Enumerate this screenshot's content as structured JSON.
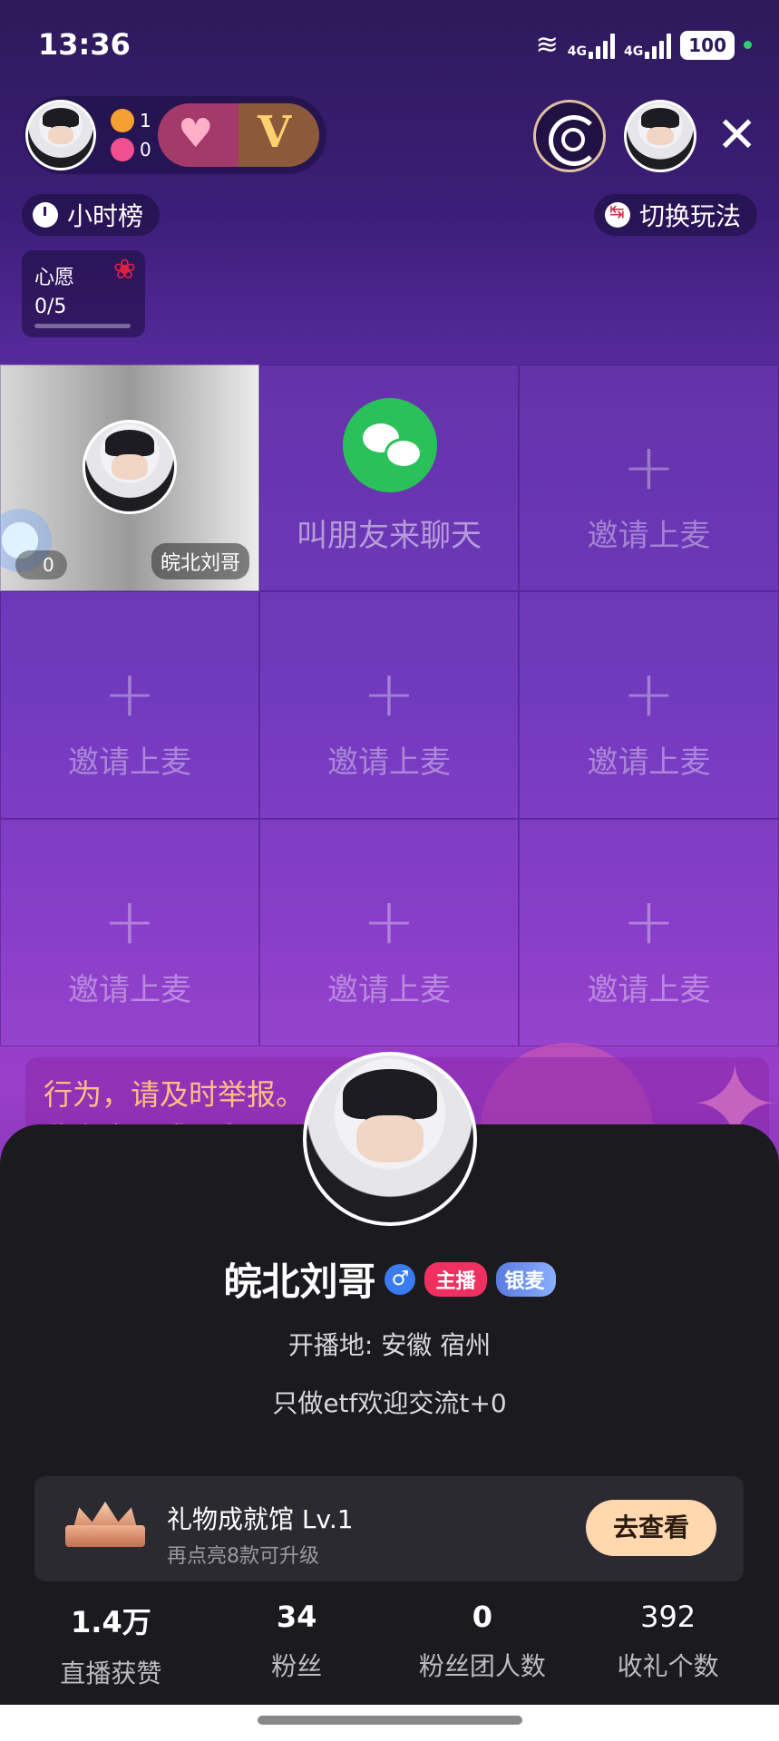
{
  "status_bar": {
    "time": "13:36",
    "net1": "4G",
    "net2": "4G",
    "battery": "100"
  },
  "room": {
    "viewers": "1",
    "likes": "0",
    "v_label": "V",
    "rank_chip": "小时榜",
    "switch_chip": "切换玩法",
    "wish": {
      "title": "心愿",
      "progress": "0/5",
      "progress_fraction": 0.0
    }
  },
  "seats": {
    "host_name": "皖北刘哥",
    "host_count": "0",
    "wechat_label": "叫朋友来聊天",
    "invite_label": "邀请上麦"
  },
  "notice": {
    "line1": "行为，请及时举报。",
    "line2": "收主商品或服务…"
  },
  "profile": {
    "name": "皖北刘哥",
    "gender": "♂",
    "badge_host": "主播",
    "badge_mic": "银麦",
    "location": "开播地: 安徽 宿州",
    "bio": "只做etf欢迎交流t+0",
    "achievement_title": "礼物成就馆 Lv.1",
    "achievement_sub": "再点亮8款可升级",
    "achievement_button": "去查看",
    "stats": [
      {
        "value": "1.4万",
        "label": "直播获赞"
      },
      {
        "value": "34",
        "label": "粉丝"
      },
      {
        "value": "0",
        "label": "粉丝团人数"
      },
      {
        "value": "392",
        "label": "收礼个数"
      }
    ]
  },
  "colors": {
    "accent_pink": "#f03060",
    "wechat_green": "#2ac05a",
    "sheet_bg": "#1b1a1f",
    "button_peach": "#ffd8b0"
  }
}
